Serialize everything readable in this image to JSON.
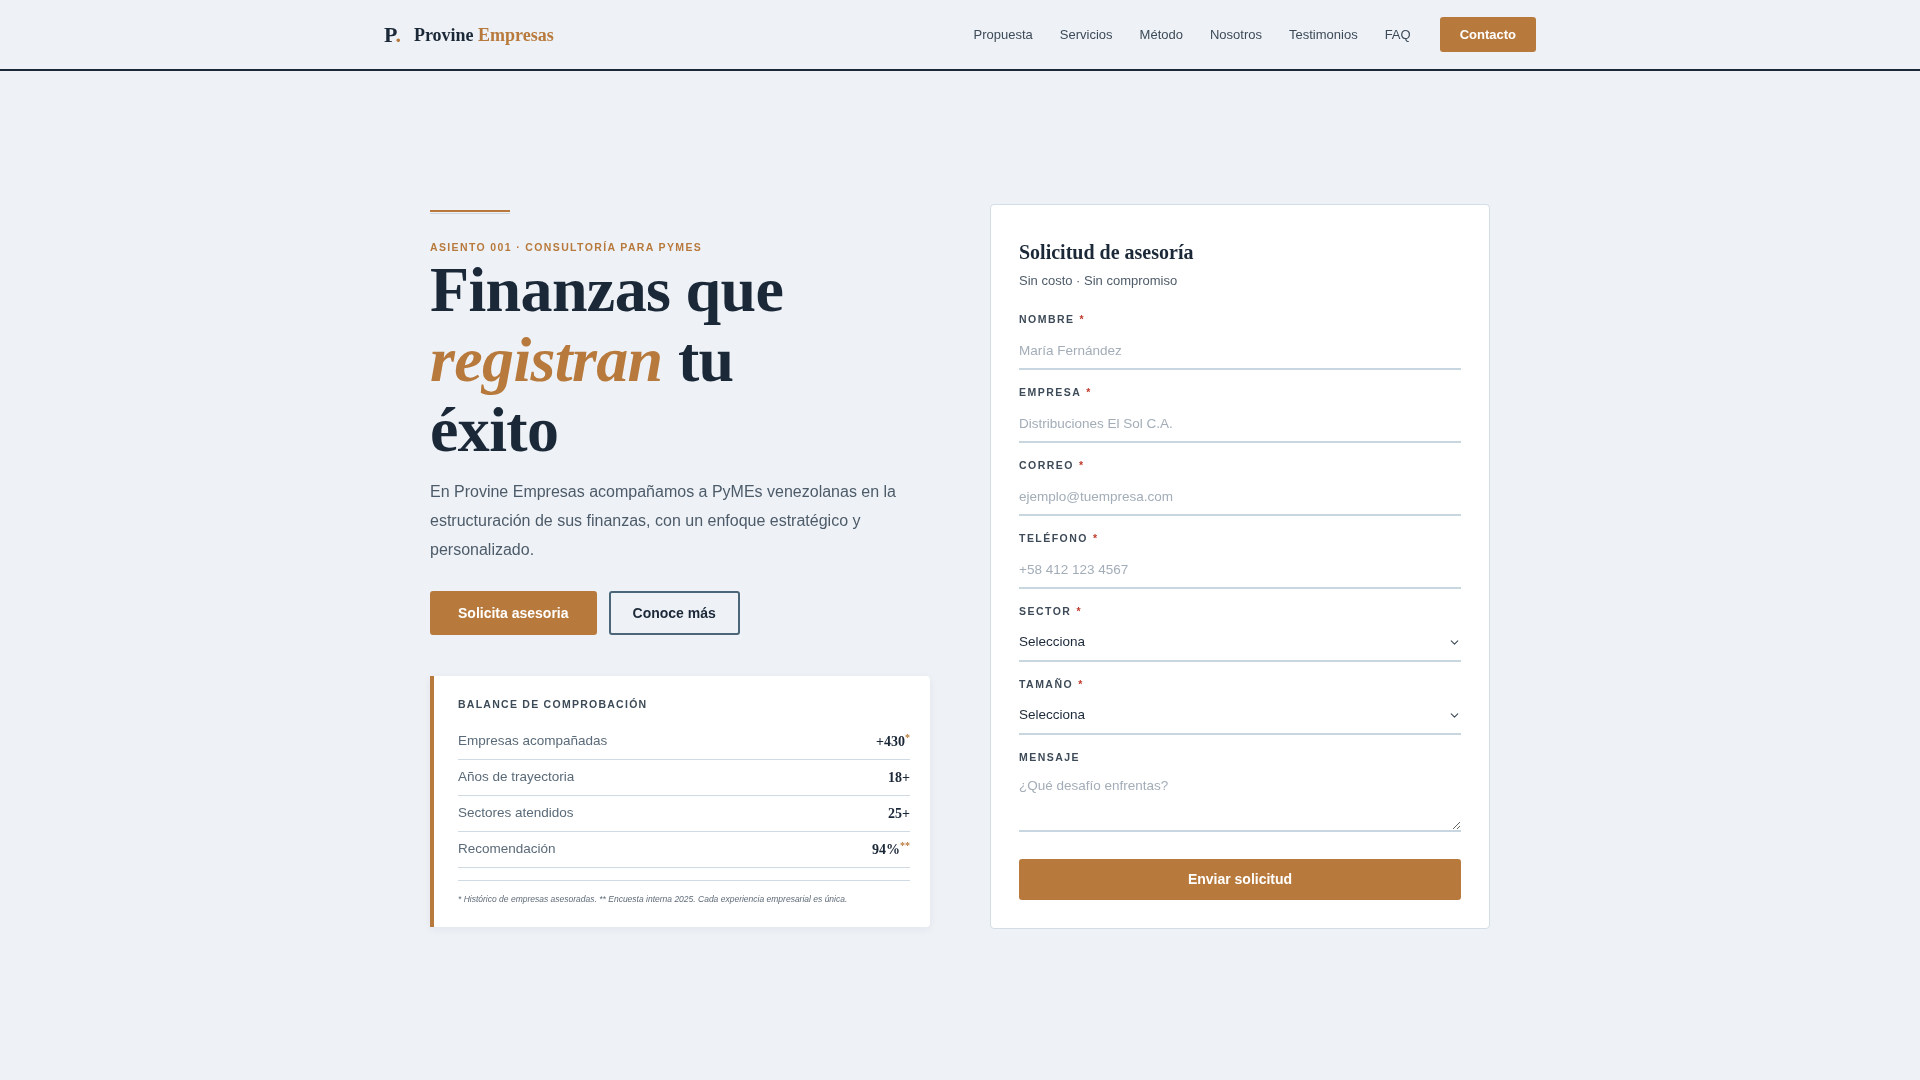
{
  "header": {
    "logo": {
      "mark": "P",
      "mark_dot": ".",
      "name": "Provine",
      "name_accent": "Empresas"
    },
    "nav": [
      {
        "label": "Propuesta"
      },
      {
        "label": "Servicios"
      },
      {
        "label": "Método"
      },
      {
        "label": "Nosotros"
      },
      {
        "label": "Testimonios"
      },
      {
        "label": "FAQ"
      }
    ],
    "cta": "Contacto"
  },
  "hero": {
    "eyebrow": "ASIENTO 001 · CONSULTORÍA PARA PYMES",
    "title": "Finanzas que *registran* tu éxito",
    "intro": "En Provine Empresas acompañamos a PyMEs venezolanas en la estructuración de sus finanzas, con un enfoque estratégico y personalizado.",
    "buttons": [
      {
        "label": "Solicita asesoria",
        "kind": "primary"
      },
      {
        "label": "Conoce más",
        "kind": "outline"
      }
    ]
  },
  "balance": {
    "title": "BALANCE DE COMPROBACIÓN",
    "rows": [
      {
        "label": "Empresas acompañadas",
        "value": "+430",
        "note": "*"
      },
      {
        "label": "Años de trayectoria",
        "value": "18+"
      },
      {
        "label": "Sectores atendidos",
        "value": "25+"
      },
      {
        "label": "Recomendación",
        "value": "94%",
        "note": "**"
      }
    ],
    "footnote": "* Histórico de empresas asesoradas. ** Encuesta interna 2025. Cada experiencia empresarial es única."
  },
  "form": {
    "title": "Solicitud de asesoría",
    "subtitle": "Sin costo · Sin compromiso",
    "fields": [
      {
        "kind": "text",
        "label": "NOMBRE",
        "mark": "*",
        "placeholder": "María Fernández"
      },
      {
        "kind": "text",
        "label": "EMPRESA",
        "mark": "*",
        "placeholder": "Distribuciones El Sol C.A."
      },
      {
        "kind": "text",
        "label": "CORREO",
        "mark": "*",
        "placeholder": "ejemplo@tuempresa.com"
      },
      {
        "kind": "text",
        "label": "TELÉFONO",
        "mark": "*",
        "placeholder": "+58 412 123 4567"
      },
      {
        "kind": "select",
        "label": "SECTOR",
        "mark": "*",
        "value": "Selecciona"
      },
      {
        "kind": "select",
        "label": "TAMAÑO",
        "mark": "*",
        "value": "Selecciona"
      },
      {
        "kind": "textarea",
        "label": "MENSAJE",
        "placeholder": "¿Qué desafío enfrentas?"
      }
    ],
    "submit": "Enviar solicitud"
  }
}
